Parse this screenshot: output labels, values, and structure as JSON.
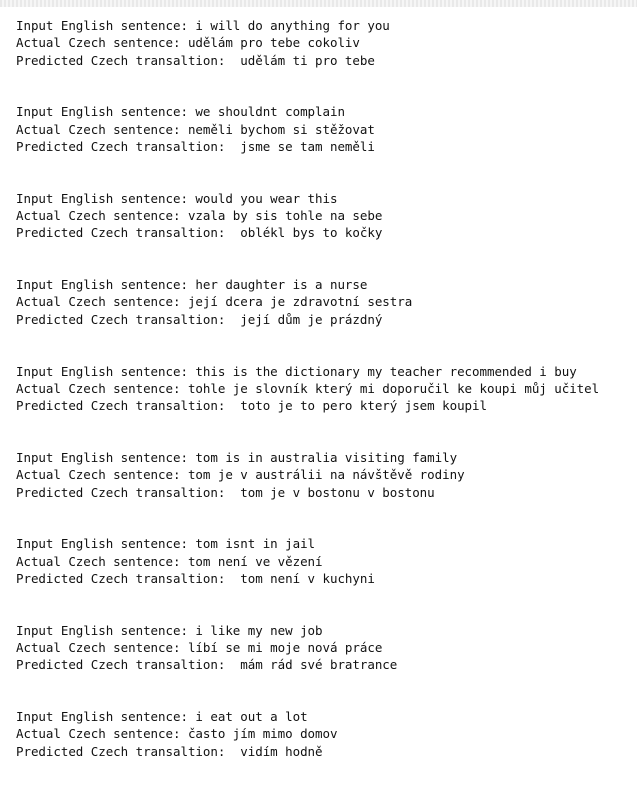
{
  "output": {
    "blocks": [
      {
        "input": "Input English sentence: i will do anything for you",
        "actual": "Actual Czech sentence: udělám pro tebe cokoliv",
        "predicted": "Predicted Czech transaltion:  udělám ti pro tebe"
      },
      {
        "input": "Input English sentence: we shouldnt complain",
        "actual": "Actual Czech sentence: neměli bychom si stěžovat",
        "predicted": "Predicted Czech transaltion:  jsme se tam neměli"
      },
      {
        "input": "Input English sentence: would you wear this",
        "actual": "Actual Czech sentence: vzala by sis tohle na sebe",
        "predicted": "Predicted Czech transaltion:  oblékl bys to kočky"
      },
      {
        "input": "Input English sentence: her daughter is a nurse",
        "actual": "Actual Czech sentence: její dcera je zdravotní sestra",
        "predicted": "Predicted Czech transaltion:  její dům je prázdný"
      },
      {
        "input": "Input English sentence: this is the dictionary my teacher recommended i buy",
        "actual": "Actual Czech sentence: tohle je slovník který mi doporučil ke koupi můj učitel",
        "predicted": "Predicted Czech transaltion:  toto je to pero který jsem koupil"
      },
      {
        "input": "Input English sentence: tom is in australia visiting family",
        "actual": "Actual Czech sentence: tom je v austrálii na návštěvě rodiny",
        "predicted": "Predicted Czech transaltion:  tom je v bostonu v bostonu"
      },
      {
        "input": "Input English sentence: tom isnt in jail",
        "actual": "Actual Czech sentence: tom není ve vězení",
        "predicted": "Predicted Czech transaltion:  tom není v kuchyni"
      },
      {
        "input": "Input English sentence: i like my new job",
        "actual": "Actual Czech sentence: líbí se mi moje nová práce",
        "predicted": "Predicted Czech transaltion:  mám rád své bratrance"
      },
      {
        "input": "Input English sentence: i eat out a lot",
        "actual": "Actual Czech sentence: často jím mimo domov",
        "predicted": "Predicted Czech transaltion:  vidím hodně"
      }
    ]
  }
}
